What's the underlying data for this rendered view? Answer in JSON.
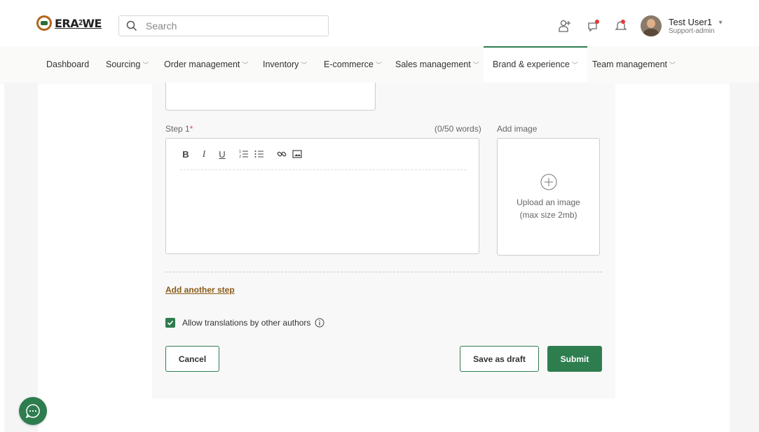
{
  "header": {
    "logo_text": "ERA⁲WE",
    "search_placeholder": "Search",
    "user": {
      "name": "Test User1",
      "role": "Support-admin"
    }
  },
  "nav": [
    {
      "label": "Dashboard",
      "has_menu": false
    },
    {
      "label": "Sourcing",
      "has_menu": true
    },
    {
      "label": "Order management",
      "has_menu": true
    },
    {
      "label": "Inventory",
      "has_menu": true
    },
    {
      "label": "E-commerce",
      "has_menu": true
    },
    {
      "label": "Sales management",
      "has_menu": true
    },
    {
      "label": "Brand & experience",
      "has_menu": true,
      "active": true
    },
    {
      "label": "Team management",
      "has_menu": true
    }
  ],
  "form": {
    "step_label": "Step 1",
    "required_mark": "*",
    "word_count": "(0/50 words)",
    "add_image_label": "Add image",
    "upload_line1": "Upload an image",
    "upload_line2": "(max size 2mb)",
    "add_step_link": "Add another step",
    "allow_translations": "Allow translations by other authors",
    "allow_translations_checked": true,
    "toolbar": [
      "bold-icon",
      "italic-icon",
      "underline-icon",
      "ordered-list-icon",
      "bullet-list-icon",
      "link-icon",
      "image-icon"
    ]
  },
  "actions": {
    "cancel": "Cancel",
    "save_draft": "Save as draft",
    "submit": "Submit"
  },
  "colors": {
    "accent": "#2e7d4f",
    "link": "#8a5a16",
    "required": "#d9534f"
  }
}
